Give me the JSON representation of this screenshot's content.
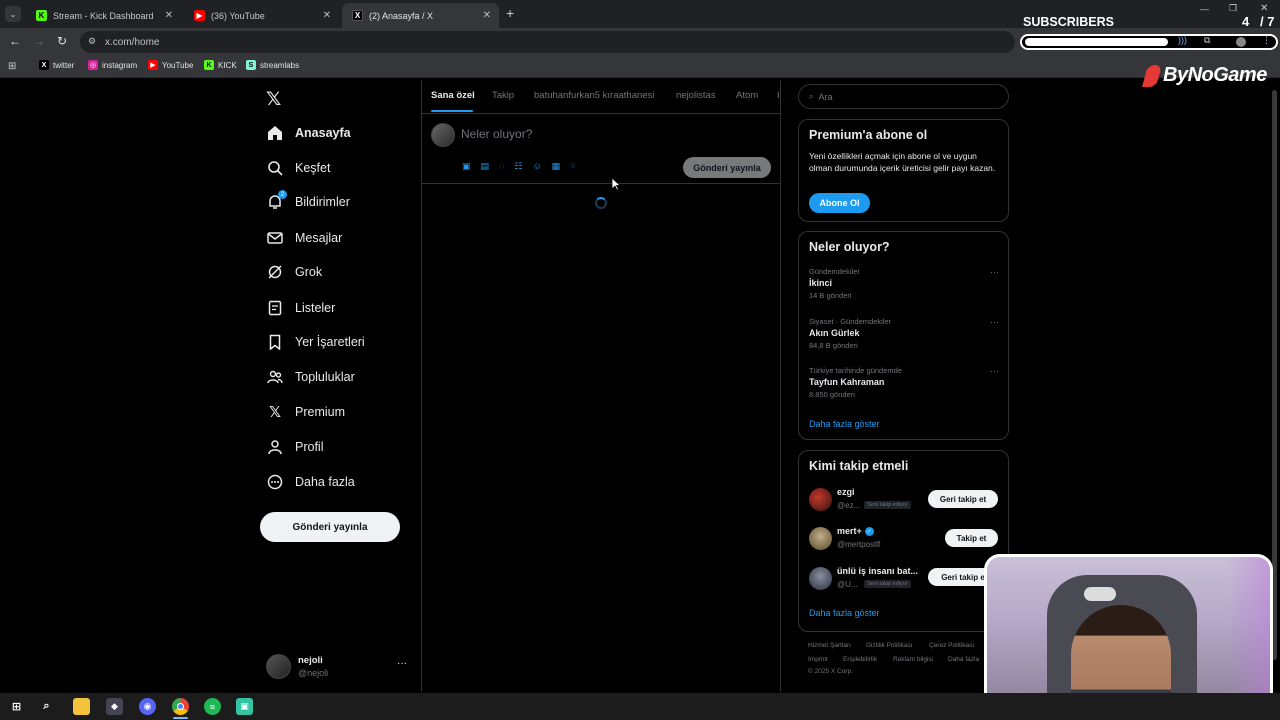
{
  "browser": {
    "tabs": [
      {
        "label": "Stream - Kick Dashboard",
        "icon": "kick-icon",
        "color": "#53fc18"
      },
      {
        "label": "(36) YouTube",
        "icon": "youtube-icon",
        "color": "#ff0000"
      },
      {
        "label": "(2) Anasayfa / X",
        "icon": "x-icon",
        "color": "#000000"
      }
    ],
    "url": "x.com/home",
    "bookmarks": [
      {
        "label": "twitter",
        "icon": "x-icon"
      },
      {
        "label": "instagram",
        "icon": "instagram-icon"
      },
      {
        "label": "YouTube",
        "icon": "youtube-icon"
      },
      {
        "label": "KICK",
        "icon": "kick-icon"
      },
      {
        "label": "streamlabs",
        "icon": "streamlabs-icon"
      }
    ]
  },
  "overlay": {
    "subscribers_label": "SUBSCRIBERS",
    "count": "4",
    "goal": "/ 7",
    "progress_fraction": 0.57,
    "brand": "ByNoGame"
  },
  "nav": {
    "items": [
      {
        "label": "Anasayfa",
        "icon": "home-icon"
      },
      {
        "label": "Keşfet",
        "icon": "search-icon"
      },
      {
        "label": "Bildirimler",
        "icon": "bell-icon",
        "badge": "2"
      },
      {
        "label": "Mesajlar",
        "icon": "mail-icon"
      },
      {
        "label": "Grok",
        "icon": "grok-icon"
      },
      {
        "label": "Listeler",
        "icon": "list-icon"
      },
      {
        "label": "Yer İşaretleri",
        "icon": "bookmark-icon"
      },
      {
        "label": "Topluluklar",
        "icon": "communities-icon"
      },
      {
        "label": "Premium",
        "icon": "x-icon"
      },
      {
        "label": "Profil",
        "icon": "user-icon"
      },
      {
        "label": "Daha fazla",
        "icon": "more-circle-icon"
      }
    ],
    "post_button": "Gönderi yayınla",
    "account": {
      "name": "nejoli",
      "handle": "@nejoli",
      "more": "···"
    }
  },
  "timeline": {
    "tabs": [
      "Sana özel",
      "Takip",
      "batuhanfurkan5 kıraathanesi",
      "nejolistas",
      "Atom",
      "I"
    ],
    "composer_placeholder": "Neler oluyor?",
    "post_button": "Gönderi yayınla"
  },
  "sidebar": {
    "search_placeholder": "Ara",
    "premium": {
      "title": "Premium'a abone ol",
      "body": "Yeni özellikleri açmak için abone ol ve uygun olman durumunda içerik üreticisi gelir payı kazan.",
      "button": "Abone Ol"
    },
    "trends": {
      "title": "Neler oluyor?",
      "items": [
        {
          "meta": "Gündemdekiler",
          "title": "İkinci",
          "count": "14 B gönderi"
        },
        {
          "meta": "Siyaset · Gündemdekiler",
          "title": "Akın Gürlek",
          "count": "84,8 B gönderi"
        },
        {
          "meta": "Türkiye tarihinde gündemde",
          "title": "Tayfun Kahraman",
          "count": "8.850 gönderi"
        }
      ],
      "more": "Daha fazla göster"
    },
    "who_to_follow": {
      "title": "Kimi takip etmeli",
      "items": [
        {
          "name": "ezgi",
          "handle": "@ez...",
          "follows_you": "Seni takip ediyor",
          "button": "Geri takip et"
        },
        {
          "name": "mert+",
          "handle": "@mertpostlf",
          "follows_you": "",
          "button": "Takip et"
        },
        {
          "name": "ünlü iş insanı bat...",
          "handle": "@U...",
          "follows_you": "Seni takip ediyor",
          "button": "Geri takip e"
        }
      ],
      "more": "Daha fazla göster"
    },
    "footer": [
      "Hizmet Şartları",
      "Gizlilik Politikası",
      "Çerez Politikası",
      "Imprint",
      "Erişilebilirlik",
      "Reklam bilgisi",
      "Daha fazla",
      "© 2025 X Corp."
    ]
  },
  "colors": {
    "accent": "#1d9bf0",
    "background": "#000000",
    "border": "#2f3336"
  }
}
